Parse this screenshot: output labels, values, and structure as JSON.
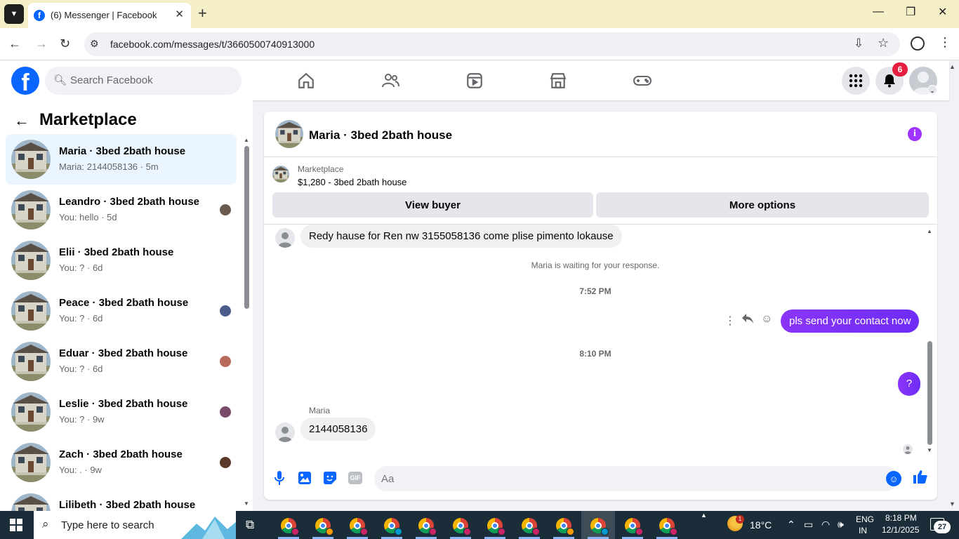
{
  "browser": {
    "tab_title": "(6) Messenger | Facebook",
    "favicon_letter": "f",
    "url": "facebook.com/messages/t/3660500740913000"
  },
  "fb_header": {
    "logo_letter": "f",
    "search_placeholder": "Search Facebook",
    "notification_count": "6"
  },
  "sidebar": {
    "title": "Marketplace",
    "conversations": [
      {
        "name": "Maria · 3bed 2bath house",
        "sub": "Maria: 2144058136 · 5m",
        "active": true
      },
      {
        "name": "Leandro · 3bed 2bath house",
        "sub": "You: hello · 5d"
      },
      {
        "name": "Elii · 3bed 2bath house",
        "sub": "You: ? · 6d"
      },
      {
        "name": "Peace · 3bed 2bath house",
        "sub": "You: ? · 6d"
      },
      {
        "name": "Eduar · 3bed 2bath house",
        "sub": "You: ? · 6d"
      },
      {
        "name": "Leslie · 3bed 2bath house",
        "sub": "You: ? · 9w"
      },
      {
        "name": "Zach · 3bed 2bath house",
        "sub": "You: . · 9w"
      },
      {
        "name": "Lilibeth · 3bed 2bath house",
        "sub": ""
      }
    ]
  },
  "chat": {
    "title": "Maria · 3bed 2bath house",
    "listing_label": "Marketplace",
    "listing_price": "$1,280 - 3bed 2bath house",
    "view_buyer": "View buyer",
    "more_options": "More options",
    "messages": {
      "incoming_1": "Redy hause for Ren nw 3155058136 come plise pimento lokause",
      "system": "Maria is waiting for your response.",
      "time_1": "7:52 PM",
      "outgoing_1": "pls send your contact now",
      "time_2": "8:10 PM",
      "outgoing_2": "?",
      "sender": "Maria",
      "incoming_2": "2144058136"
    },
    "composer_placeholder": "Aa",
    "gif_label": "GIF"
  },
  "taskbar": {
    "search_placeholder": "Type here to search",
    "weather": "18°C",
    "weather_badge": "1",
    "lang_1": "ENG",
    "lang_2": "IN",
    "time": "8:18 PM",
    "date": "12/1/2025",
    "notifications": "27"
  },
  "colors": {
    "fb_blue": "#0866ff",
    "messenger_purple": "#7c2dfd",
    "tabbar": "#f5efc7",
    "taskbar": "#1c2d3a"
  }
}
